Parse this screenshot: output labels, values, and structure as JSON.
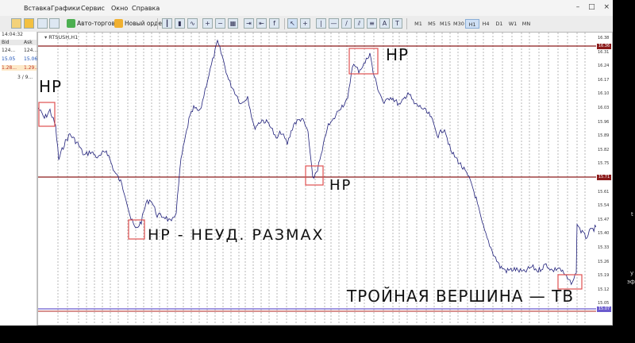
{
  "menu": {
    "items": [
      "Вставка",
      "Графики",
      "Сервис",
      "Окно",
      "Справка"
    ],
    "window_controls": [
      "–",
      "□",
      "×"
    ]
  },
  "toolbar": {
    "autotrade_label": "Авто-торговля",
    "new_order_label": "Новый ордер",
    "timeframes": [
      "M1",
      "M5",
      "M15",
      "M30",
      "H1",
      "H4",
      "D1",
      "W1",
      "MN"
    ],
    "active_timeframe": "H1"
  },
  "market_watch": {
    "time": "14:04:32",
    "header_bid": "Bid",
    "header_ask": "Ask",
    "rows": [
      {
        "bid": "124...",
        "ask": "124..."
      },
      {
        "bid": "15.05",
        "ask": "15.06"
      },
      {
        "bid": "1.28...",
        "ask": "1.29..."
      }
    ],
    "footer": "3 / 9..."
  },
  "chart": {
    "title": "RTSUSH,H1",
    "price_labels": [
      "16.38",
      "16.31",
      "16.24",
      "16.17",
      "16.10",
      "16.03",
      "15.96",
      "15.89",
      "15.82",
      "15.75",
      "15.68",
      "15.61",
      "15.54",
      "15.47",
      "15.40",
      "15.33",
      "15.26",
      "15.19",
      "15.12",
      "15.05"
    ],
    "level_tags": [
      "16.36",
      "15.71",
      "15.07"
    ],
    "line_color": "#1f1f7a",
    "level_color": "#8b1a1a",
    "box_color": "#e05050"
  },
  "annotations": {
    "hp_left": "НР",
    "hp_top": "НР",
    "hp_mid": "НР",
    "failed_swing": "НР - НЕУД. РАЗМАХ",
    "triple_top": "ТРОЙНАЯ ВЕРШИНА — ТВ"
  },
  "edge_text": {
    "right_a": "t",
    "right_b": "у",
    "right_c": "эф"
  }
}
